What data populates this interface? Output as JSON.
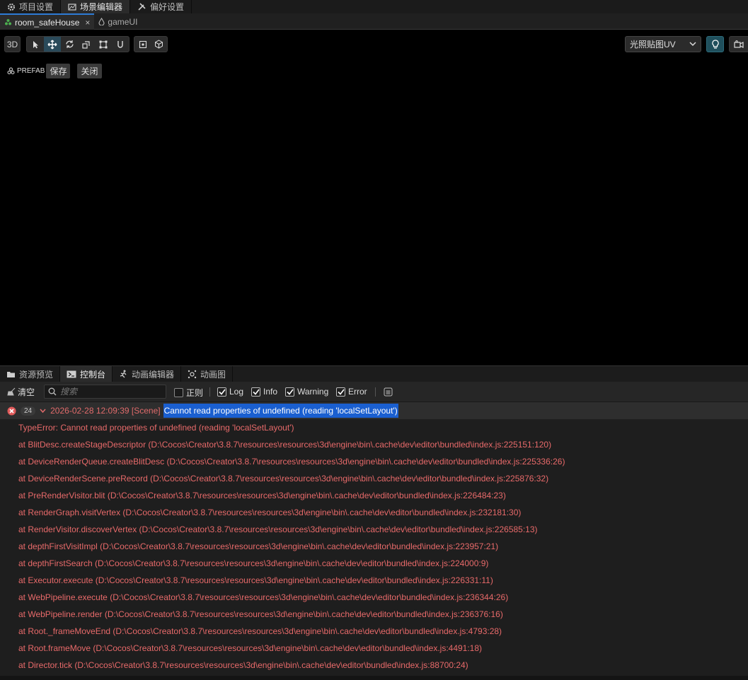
{
  "top_tabs": [
    {
      "label": "项目设置",
      "icon": "gear-icon"
    },
    {
      "label": "场景编辑器",
      "icon": "scene-icon"
    },
    {
      "label": "偏好设置",
      "icon": "tools-icon"
    }
  ],
  "doc_tabs": [
    {
      "label": "room_safeHouse",
      "icon": "prefab-icon",
      "close": "×"
    },
    {
      "label": "gameUI",
      "icon": "drop-icon"
    }
  ],
  "scene_toolbar": {
    "mode_3d": "3D",
    "lightmap_select": "光照贴图UV"
  },
  "prefab_bar": {
    "label": "PREFAB",
    "save": "保存",
    "close": "关闭"
  },
  "panel_tabs": [
    {
      "label": "资源预览",
      "icon": "folder-icon"
    },
    {
      "label": "控制台",
      "icon": "terminal-icon"
    },
    {
      "label": "动画编辑器",
      "icon": "running-icon"
    },
    {
      "label": "动画图",
      "icon": "graph-icon"
    }
  ],
  "console_toolbar": {
    "clear": "清空",
    "search_placeholder": "搜索",
    "regex": "正则",
    "log": "Log",
    "info": "Info",
    "warning": "Warning",
    "error": "Error"
  },
  "console_entry": {
    "count": "24",
    "time": "2026-02-28 12:09:39 [Scene]",
    "message": "Cannot read properties of undefined (reading 'localSetLayout')",
    "stack": [
      "TypeError: Cannot read properties of undefined (reading 'localSetLayout')",
      "at BlitDesc.createStageDescriptor (D:\\Cocos\\Creator\\3.8.7\\resources\\resources\\3d\\engine\\bin\\.cache\\dev\\editor\\bundled\\index.js:225151:120)",
      "at DeviceRenderQueue.createBlitDesc (D:\\Cocos\\Creator\\3.8.7\\resources\\resources\\3d\\engine\\bin\\.cache\\dev\\editor\\bundled\\index.js:225336:26)",
      "at DeviceRenderScene.preRecord (D:\\Cocos\\Creator\\3.8.7\\resources\\resources\\3d\\engine\\bin\\.cache\\dev\\editor\\bundled\\index.js:225876:32)",
      "at PreRenderVisitor.blit (D:\\Cocos\\Creator\\3.8.7\\resources\\resources\\3d\\engine\\bin\\.cache\\dev\\editor\\bundled\\index.js:226484:23)",
      "at RenderGraph.visitVertex (D:\\Cocos\\Creator\\3.8.7\\resources\\resources\\3d\\engine\\bin\\.cache\\dev\\editor\\bundled\\index.js:232181:30)",
      "at RenderVisitor.discoverVertex (D:\\Cocos\\Creator\\3.8.7\\resources\\resources\\3d\\engine\\bin\\.cache\\dev\\editor\\bundled\\index.js:226585:13)",
      "at depthFirstVisitImpl (D:\\Cocos\\Creator\\3.8.7\\resources\\resources\\3d\\engine\\bin\\.cache\\dev\\editor\\bundled\\index.js:223957:21)",
      "at depthFirstSearch (D:\\Cocos\\Creator\\3.8.7\\resources\\resources\\3d\\engine\\bin\\.cache\\dev\\editor\\bundled\\index.js:224000:9)",
      "at Executor.execute (D:\\Cocos\\Creator\\3.8.7\\resources\\resources\\3d\\engine\\bin\\.cache\\dev\\editor\\bundled\\index.js:226331:11)",
      "at WebPipeline.execute (D:\\Cocos\\Creator\\3.8.7\\resources\\resources\\3d\\engine\\bin\\.cache\\dev\\editor\\bundled\\index.js:236344:26)",
      "at WebPipeline.render (D:\\Cocos\\Creator\\3.8.7\\resources\\resources\\3d\\engine\\bin\\.cache\\dev\\editor\\bundled\\index.js:236376:16)",
      "at Root._frameMoveEnd (D:\\Cocos\\Creator\\3.8.7\\resources\\resources\\3d\\engine\\bin\\.cache\\dev\\editor\\bundled\\index.js:4793:28)",
      "at Root.frameMove (D:\\Cocos\\Creator\\3.8.7\\resources\\resources\\3d\\engine\\bin\\.cache\\dev\\editor\\bundled\\index.js:4491:18)",
      "at Director.tick (D:\\Cocos\\Creator\\3.8.7\\resources\\resources\\3d\\engine\\bin\\.cache\\dev\\editor\\bundled\\index.js:88700:24)"
    ]
  },
  "colors": {
    "error_text": "#e86a6a",
    "selection": "#1a5fd0",
    "accent": "#2d7bd6"
  }
}
